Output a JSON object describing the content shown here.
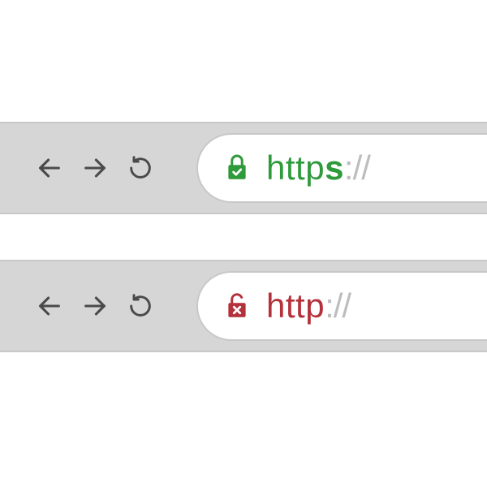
{
  "bars": [
    {
      "id": "secure",
      "lock_icon": "lock-closed-check",
      "lock_color": "#2e9a3a",
      "scheme": "https",
      "scheme_color": "#2e9a3a",
      "emphasize_s": true,
      "slashes": "://"
    },
    {
      "id": "insecure",
      "lock_icon": "lock-open-cross",
      "lock_color": "#b4303a",
      "scheme": "http",
      "scheme_color": "#b4303a",
      "emphasize_s": false,
      "slashes": "://"
    }
  ],
  "nav": {
    "back_icon": "arrow-left",
    "forward_icon": "arrow-right",
    "reload_icon": "reload"
  }
}
